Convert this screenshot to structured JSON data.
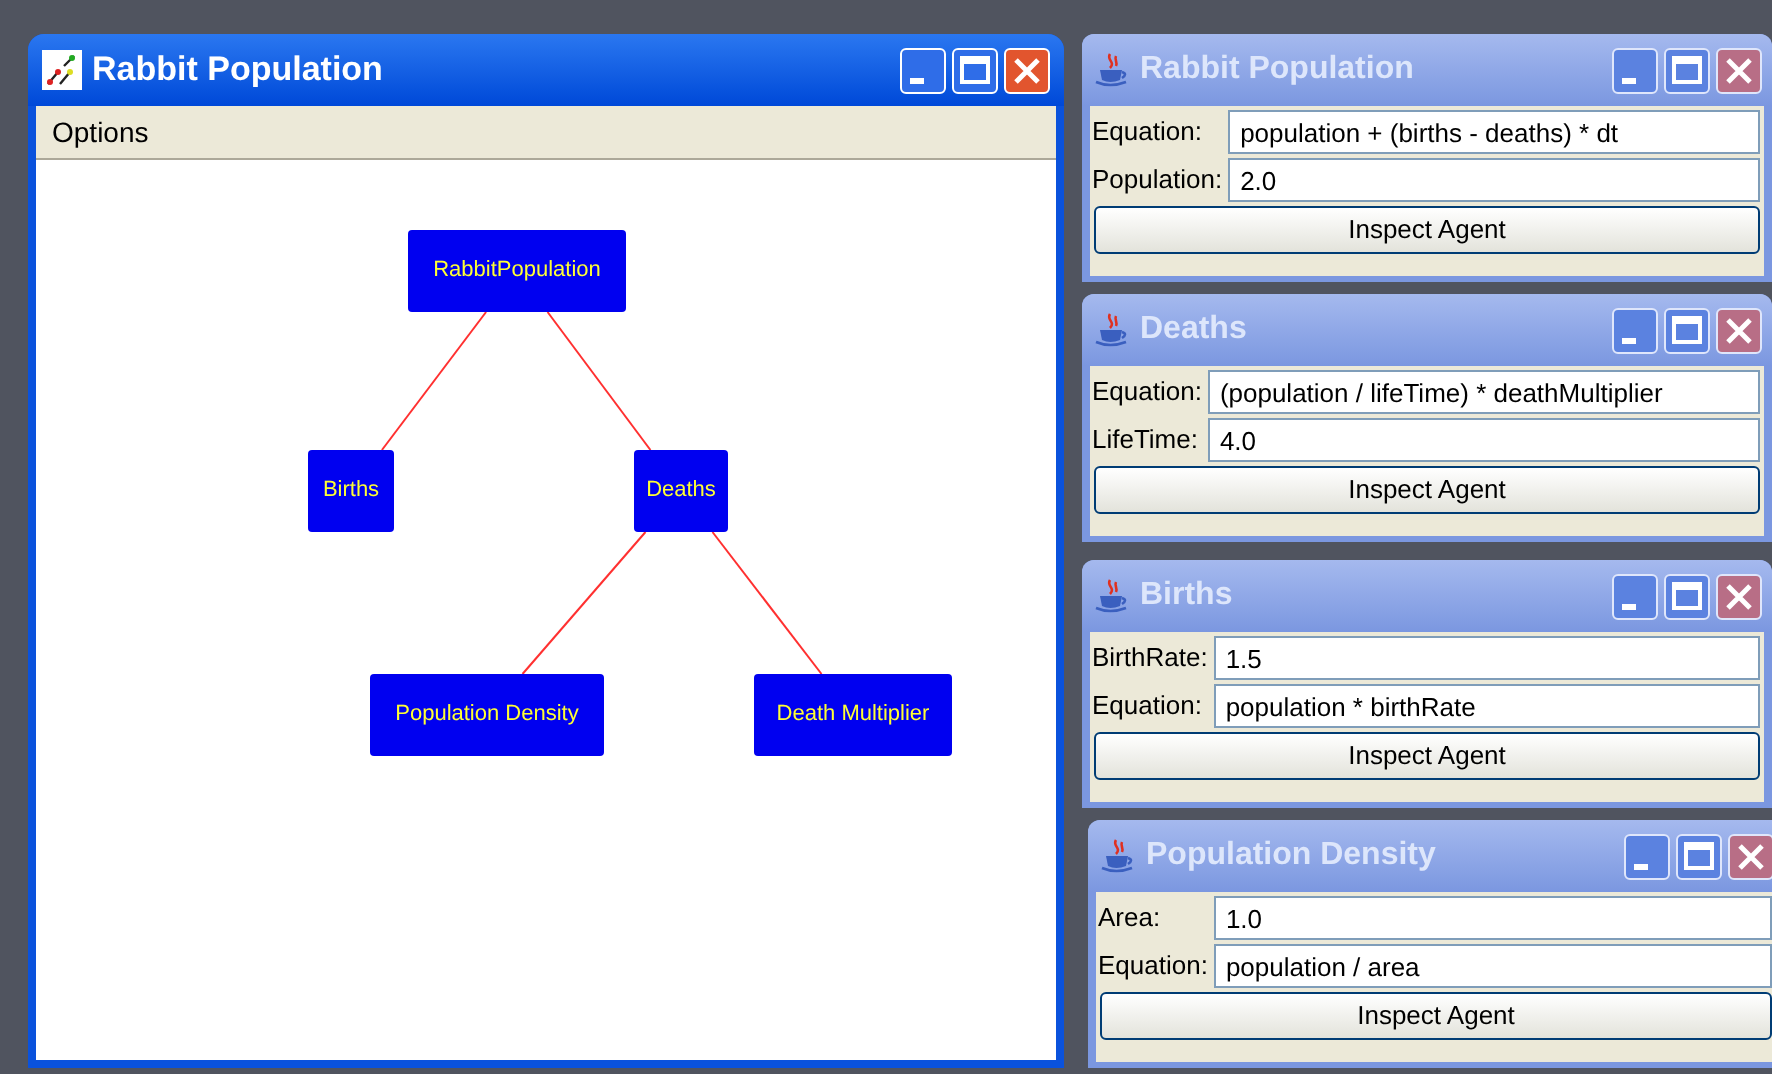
{
  "main_window": {
    "title": "Rabbit Population",
    "active": true,
    "menu": [
      "Options"
    ],
    "diagram": {
      "label": "RabbitPopulation",
      "children": [
        {
          "label": "Births"
        },
        {
          "label": "Deaths",
          "children": [
            {
              "label": "Population Density"
            },
            {
              "label": "Death Multiplier"
            }
          ]
        }
      ]
    }
  },
  "inspectors": [
    {
      "title": "Rabbit Population",
      "active": false,
      "fields": [
        {
          "label": "Equation:",
          "value": "population + (births - deaths) * dt"
        },
        {
          "label": "Population:",
          "value": "2.0"
        }
      ],
      "button": "Inspect Agent"
    },
    {
      "title": "Deaths",
      "active": false,
      "fields": [
        {
          "label": "Equation:",
          "value": "(population / lifeTime) * deathMultiplier"
        },
        {
          "label": "LifeTime:",
          "value": "4.0"
        }
      ],
      "button": "Inspect Agent"
    },
    {
      "title": "Births",
      "active": false,
      "fields": [
        {
          "label": "BirthRate:",
          "value": "1.5"
        },
        {
          "label": "Equation:",
          "value": "population * birthRate"
        }
      ],
      "button": "Inspect Agent"
    },
    {
      "title": "Population Density",
      "active": false,
      "fields": [
        {
          "label": "Area:",
          "value": "1.0"
        },
        {
          "label": "Equation:",
          "value": "population / area"
        }
      ],
      "button": "Inspect Agent"
    }
  ]
}
